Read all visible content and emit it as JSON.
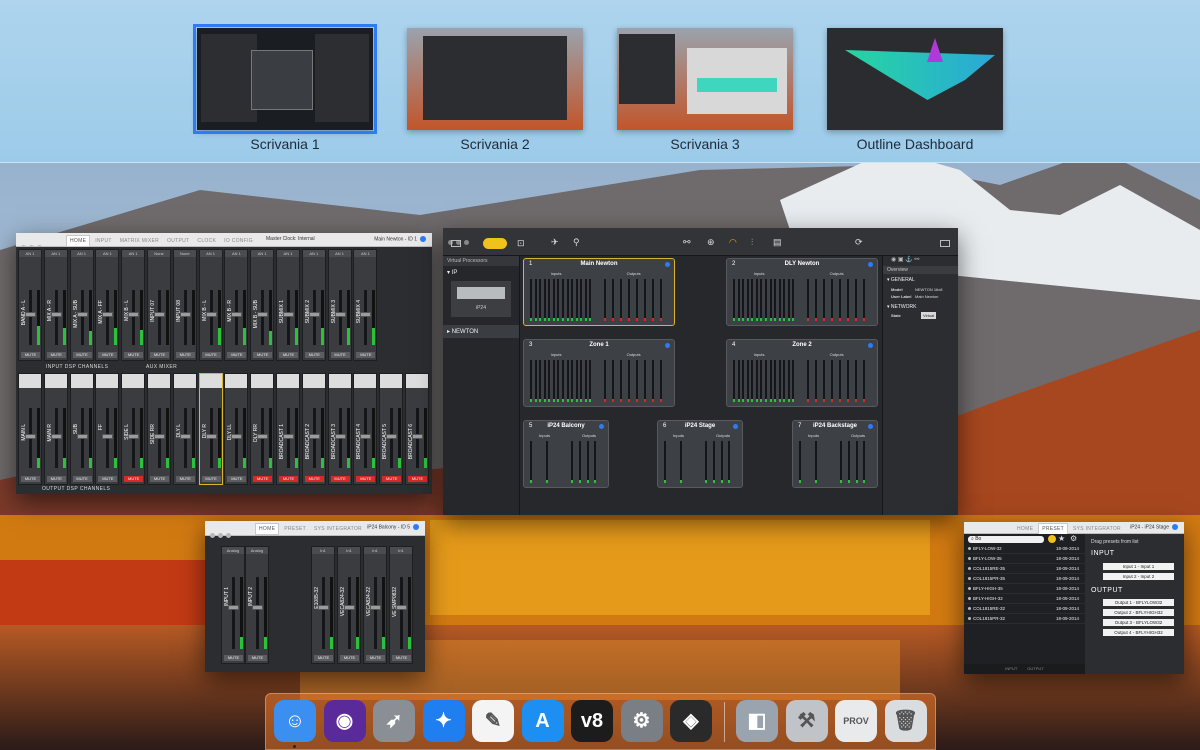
{
  "spaces": [
    {
      "label": "Scrivania 1",
      "active": true
    },
    {
      "label": "Scrivania 2",
      "active": false
    },
    {
      "label": "Scrivania 3",
      "active": false
    },
    {
      "label": "Outline Dashboard",
      "active": false
    }
  ],
  "mixer_window": {
    "tabs": [
      "HOME",
      "INPUT",
      "MATRIX MIXER",
      "OUTPUT",
      "CLOCK",
      "IO CONFIG"
    ],
    "master_clock": "Master Clock: Internal",
    "device": "Main Newton - ID 1",
    "input_label": "INPUT DSP CHANNELS",
    "aux_label": "AUX MIXER",
    "output_label": "OUTPUT DSP CHANNELS",
    "mute": "MUTE",
    "top_strips": [
      {
        "hdr": "AN 1",
        "name": "BAND A - L",
        "level": 0.35
      },
      {
        "hdr": "AN 1",
        "name": "MIX A - R",
        "level": 0.3
      },
      {
        "hdr": "AN 1",
        "name": "MIX A - SUB",
        "level": 0.25
      },
      {
        "hdr": "AN 1",
        "name": "MIX A - FF",
        "level": 0.3
      },
      {
        "hdr": "AN 1",
        "name": "MIX B - L",
        "level": 0.28
      },
      {
        "hdr": "None",
        "name": "INPUT 07",
        "level": 0.0
      },
      {
        "hdr": "None",
        "name": "INPUT 08",
        "level": 0.0
      },
      {
        "hdr": "AN 1",
        "name": "MIX B - L",
        "level": 0.3
      },
      {
        "hdr": "AN 1",
        "name": "MIX B - R",
        "level": 0.3
      },
      {
        "hdr": "AN 1",
        "name": "MIX B - SUB",
        "level": 0.25
      },
      {
        "hdr": "AN 1",
        "name": "SUBMIX 1",
        "level": 0.3
      },
      {
        "hdr": "AN 1",
        "name": "SUBMIX 2",
        "level": 0.3
      },
      {
        "hdr": "AN 1",
        "name": "SUBMIX 3",
        "level": 0.3
      },
      {
        "hdr": "AN 1",
        "name": "SUBMIX 4",
        "level": 0.3
      }
    ],
    "bottom_strips": [
      {
        "name": "MAIN L",
        "red": false
      },
      {
        "name": "MAIN R",
        "red": false
      },
      {
        "name": "SUB",
        "red": false
      },
      {
        "name": "FF",
        "red": false
      },
      {
        "name": "SIDE L",
        "red": true
      },
      {
        "name": "SIDE RR",
        "red": false
      },
      {
        "name": "DLY L",
        "red": false
      },
      {
        "name": "DLY R",
        "red": false
      },
      {
        "name": "DLY LL",
        "red": false
      },
      {
        "name": "DLY RR",
        "red": true
      },
      {
        "name": "BROADCAST 1",
        "red": true
      },
      {
        "name": "BROADCAST 2",
        "red": true
      },
      {
        "name": "BROADCAST 3",
        "red": true
      },
      {
        "name": "BROADCAST 4",
        "red": true
      },
      {
        "name": "BROADCAST 5",
        "red": true
      },
      {
        "name": "BROADCAST 6",
        "red": true
      }
    ]
  },
  "newton_window": {
    "sidebar_header": "Virtual Processors",
    "group_ip": "IP",
    "device_thumb": "iP24",
    "group_newton": "NEWTON",
    "devices": [
      {
        "num": "1",
        "name": "Main Newton"
      },
      {
        "num": "2",
        "name": "DLY Newton"
      },
      {
        "num": "3",
        "name": "Zone 1"
      },
      {
        "num": "4",
        "name": "Zone 2"
      },
      {
        "num": "5",
        "name": "iP24 Balcony"
      },
      {
        "num": "6",
        "name": "iP24 Stage"
      },
      {
        "num": "7",
        "name": "iP24 Backstage"
      }
    ],
    "inputs_label": "Inputs",
    "outputs_label": "Outputs",
    "overview": {
      "title": "Overview",
      "general": "GENERAL",
      "model_k": "Model",
      "model_v": "NEWTON 16x8",
      "user_label_k": "User Label",
      "user_label_v": "Main Newton",
      "network": "NETWORK",
      "state_k": "State",
      "state_v": "Virtual"
    }
  },
  "ip24_window": {
    "tabs": [
      "HOME",
      "PRESET",
      "SYS INTEGRATOR"
    ],
    "device": "iP24 Balcony - ID 5",
    "mute": "MUTE",
    "inputs": [
      {
        "hdr": "Analog",
        "name": "INPUT 1"
      },
      {
        "hdr": "Analog",
        "name": "INPUT 2"
      }
    ],
    "outputs": [
      {
        "hdr": "In1",
        "name": "E1085-32"
      },
      {
        "hdr": "In1",
        "name": "VECA824-32"
      },
      {
        "hdr": "In1",
        "name": "VECA824-22"
      },
      {
        "hdr": "In1",
        "name": "VE SMP0832"
      }
    ]
  },
  "preset_window": {
    "tabs": [
      "HOME",
      "PRESET",
      "SYS INTEGRATOR"
    ],
    "device": "iP24 - iP24 Stage",
    "search_value": "Bo",
    "drag_hint": "Drag presets from list",
    "input_label": "INPUT",
    "output_label": "OUTPUT",
    "presets": [
      {
        "name": "BFLY-LOW-32",
        "date": "18-09-2014"
      },
      {
        "name": "BFLY-LOW-35",
        "date": "18-09-2014"
      },
      {
        "name": "COL1815RE-35",
        "date": "18-09-2014"
      },
      {
        "name": "COL1815PR-35",
        "date": "18-09-2014"
      },
      {
        "name": "BFLY-HIGH-35",
        "date": "18-09-2014"
      },
      {
        "name": "BFLY-HIGH-32",
        "date": "18-09-2014"
      },
      {
        "name": "COL1815RE-32",
        "date": "18-09-2014"
      },
      {
        "name": "COL1815PR-32",
        "date": "18-09-2014"
      }
    ],
    "input_slots": [
      "Input 1 - Input 1",
      "Input 2 - Input 2"
    ],
    "output_slots": [
      "Output 1 - BFLYLOW32",
      "Output 2 - BFLYHIGH32",
      "Output 3 - BFLYLOW32",
      "Output 4 - BFLYHIGH32"
    ],
    "footer_tabs": [
      "INPUT",
      "OUTPUT"
    ]
  },
  "dock": {
    "items": [
      {
        "icon": "finder-icon",
        "color": "#3b8ff0",
        "glyph": "☺",
        "running": true
      },
      {
        "icon": "siri-icon",
        "color": "#5a2a9a",
        "glyph": "◉",
        "running": false
      },
      {
        "icon": "launchpad-icon",
        "color": "#8a8f96",
        "glyph": "➶",
        "running": false
      },
      {
        "icon": "safari-icon",
        "color": "#1f7ef0",
        "glyph": "✦",
        "running": false
      },
      {
        "icon": "textedit-icon",
        "color": "#f4f4f4",
        "glyph": "✎",
        "running": false
      },
      {
        "icon": "app-store-icon",
        "color": "#1d8ff2",
        "glyph": "A",
        "running": false
      },
      {
        "icon": "v8-icon",
        "color": "#1c1c1c",
        "glyph": "v8",
        "running": false
      },
      {
        "icon": "system-preferences-icon",
        "color": "#7a7f86",
        "glyph": "⚙",
        "running": false
      },
      {
        "icon": "armonia-icon",
        "color": "#2a2a2a",
        "glyph": "◈",
        "running": false
      },
      {
        "icon": "preview-icon",
        "color": "#9aa4ae",
        "glyph": "◧",
        "running": false
      },
      {
        "icon": "utility-icon",
        "color": "#c0c4c8",
        "glyph": "⚒",
        "running": false
      },
      {
        "icon": "prov-file-icon",
        "color": "#e9eaeb",
        "glyph": "PROV",
        "running": false
      },
      {
        "icon": "trash-icon",
        "color": "#d9dde0",
        "glyph": "🗑",
        "running": false
      }
    ]
  }
}
